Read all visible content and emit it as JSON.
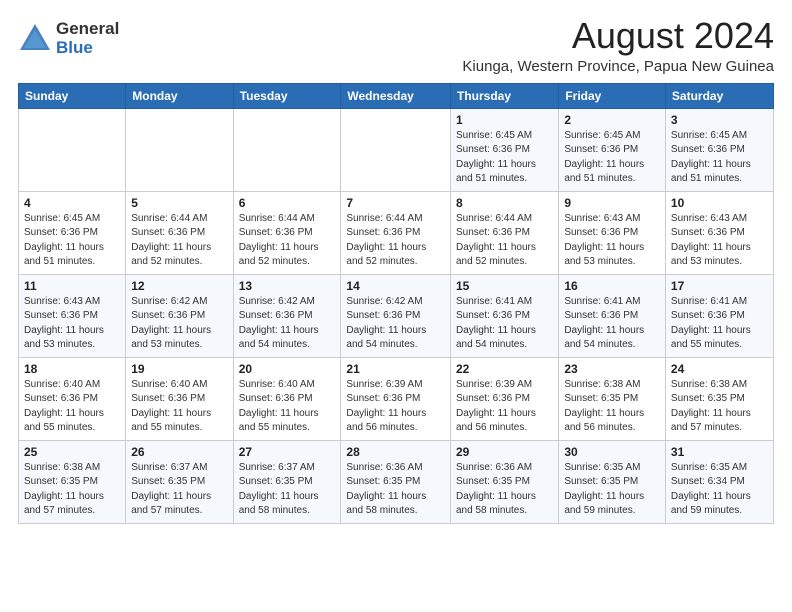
{
  "logo": {
    "general": "General",
    "blue": "Blue"
  },
  "header": {
    "month_year": "August 2024",
    "location": "Kiunga, Western Province, Papua New Guinea"
  },
  "weekdays": [
    "Sunday",
    "Monday",
    "Tuesday",
    "Wednesday",
    "Thursday",
    "Friday",
    "Saturday"
  ],
  "weeks": [
    [
      {
        "day": "",
        "info": ""
      },
      {
        "day": "",
        "info": ""
      },
      {
        "day": "",
        "info": ""
      },
      {
        "day": "",
        "info": ""
      },
      {
        "day": "1",
        "info": "Sunrise: 6:45 AM\nSunset: 6:36 PM\nDaylight: 11 hours\nand 51 minutes."
      },
      {
        "day": "2",
        "info": "Sunrise: 6:45 AM\nSunset: 6:36 PM\nDaylight: 11 hours\nand 51 minutes."
      },
      {
        "day": "3",
        "info": "Sunrise: 6:45 AM\nSunset: 6:36 PM\nDaylight: 11 hours\nand 51 minutes."
      }
    ],
    [
      {
        "day": "4",
        "info": "Sunrise: 6:45 AM\nSunset: 6:36 PM\nDaylight: 11 hours\nand 51 minutes."
      },
      {
        "day": "5",
        "info": "Sunrise: 6:44 AM\nSunset: 6:36 PM\nDaylight: 11 hours\nand 52 minutes."
      },
      {
        "day": "6",
        "info": "Sunrise: 6:44 AM\nSunset: 6:36 PM\nDaylight: 11 hours\nand 52 minutes."
      },
      {
        "day": "7",
        "info": "Sunrise: 6:44 AM\nSunset: 6:36 PM\nDaylight: 11 hours\nand 52 minutes."
      },
      {
        "day": "8",
        "info": "Sunrise: 6:44 AM\nSunset: 6:36 PM\nDaylight: 11 hours\nand 52 minutes."
      },
      {
        "day": "9",
        "info": "Sunrise: 6:43 AM\nSunset: 6:36 PM\nDaylight: 11 hours\nand 53 minutes."
      },
      {
        "day": "10",
        "info": "Sunrise: 6:43 AM\nSunset: 6:36 PM\nDaylight: 11 hours\nand 53 minutes."
      }
    ],
    [
      {
        "day": "11",
        "info": "Sunrise: 6:43 AM\nSunset: 6:36 PM\nDaylight: 11 hours\nand 53 minutes."
      },
      {
        "day": "12",
        "info": "Sunrise: 6:42 AM\nSunset: 6:36 PM\nDaylight: 11 hours\nand 53 minutes."
      },
      {
        "day": "13",
        "info": "Sunrise: 6:42 AM\nSunset: 6:36 PM\nDaylight: 11 hours\nand 54 minutes."
      },
      {
        "day": "14",
        "info": "Sunrise: 6:42 AM\nSunset: 6:36 PM\nDaylight: 11 hours\nand 54 minutes."
      },
      {
        "day": "15",
        "info": "Sunrise: 6:41 AM\nSunset: 6:36 PM\nDaylight: 11 hours\nand 54 minutes."
      },
      {
        "day": "16",
        "info": "Sunrise: 6:41 AM\nSunset: 6:36 PM\nDaylight: 11 hours\nand 54 minutes."
      },
      {
        "day": "17",
        "info": "Sunrise: 6:41 AM\nSunset: 6:36 PM\nDaylight: 11 hours\nand 55 minutes."
      }
    ],
    [
      {
        "day": "18",
        "info": "Sunrise: 6:40 AM\nSunset: 6:36 PM\nDaylight: 11 hours\nand 55 minutes."
      },
      {
        "day": "19",
        "info": "Sunrise: 6:40 AM\nSunset: 6:36 PM\nDaylight: 11 hours\nand 55 minutes."
      },
      {
        "day": "20",
        "info": "Sunrise: 6:40 AM\nSunset: 6:36 PM\nDaylight: 11 hours\nand 55 minutes."
      },
      {
        "day": "21",
        "info": "Sunrise: 6:39 AM\nSunset: 6:36 PM\nDaylight: 11 hours\nand 56 minutes."
      },
      {
        "day": "22",
        "info": "Sunrise: 6:39 AM\nSunset: 6:36 PM\nDaylight: 11 hours\nand 56 minutes."
      },
      {
        "day": "23",
        "info": "Sunrise: 6:38 AM\nSunset: 6:35 PM\nDaylight: 11 hours\nand 56 minutes."
      },
      {
        "day": "24",
        "info": "Sunrise: 6:38 AM\nSunset: 6:35 PM\nDaylight: 11 hours\nand 57 minutes."
      }
    ],
    [
      {
        "day": "25",
        "info": "Sunrise: 6:38 AM\nSunset: 6:35 PM\nDaylight: 11 hours\nand 57 minutes."
      },
      {
        "day": "26",
        "info": "Sunrise: 6:37 AM\nSunset: 6:35 PM\nDaylight: 11 hours\nand 57 minutes."
      },
      {
        "day": "27",
        "info": "Sunrise: 6:37 AM\nSunset: 6:35 PM\nDaylight: 11 hours\nand 58 minutes."
      },
      {
        "day": "28",
        "info": "Sunrise: 6:36 AM\nSunset: 6:35 PM\nDaylight: 11 hours\nand 58 minutes."
      },
      {
        "day": "29",
        "info": "Sunrise: 6:36 AM\nSunset: 6:35 PM\nDaylight: 11 hours\nand 58 minutes."
      },
      {
        "day": "30",
        "info": "Sunrise: 6:35 AM\nSunset: 6:35 PM\nDaylight: 11 hours\nand 59 minutes."
      },
      {
        "day": "31",
        "info": "Sunrise: 6:35 AM\nSunset: 6:34 PM\nDaylight: 11 hours\nand 59 minutes."
      }
    ]
  ]
}
